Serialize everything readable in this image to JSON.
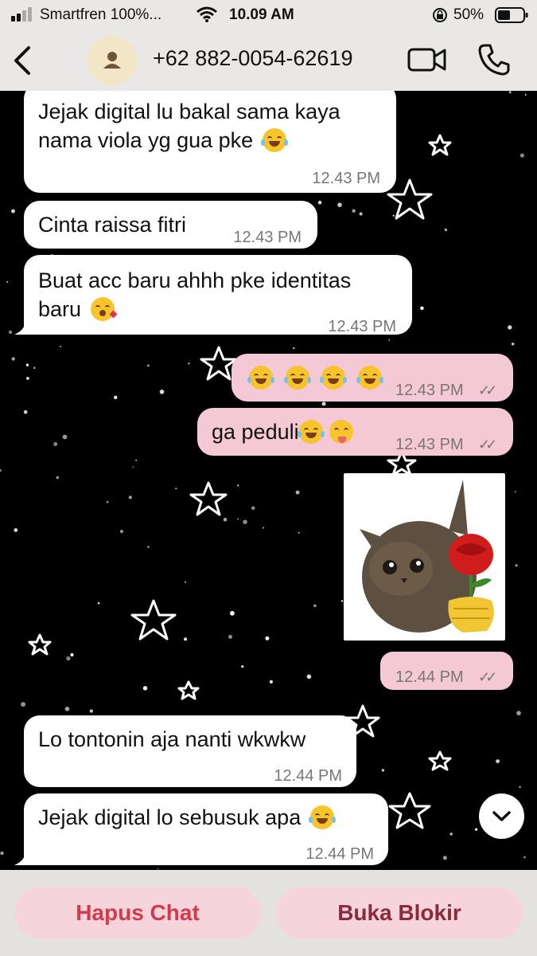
{
  "status_bar": {
    "carrier": "Smartfren 100%...",
    "time": "10.09 AM",
    "battery": "50%"
  },
  "header": {
    "back_icon": "chevron-left-icon",
    "contact_name": "+62 882-0054-62619",
    "video_icon": "video-camera-icon",
    "call_icon": "phone-icon"
  },
  "messages": [
    {
      "direction": "in",
      "lines": [
        "Jejak digital lu bakal sama kaya",
        "nama viola yg gua pke"
      ],
      "emoji": "rofl",
      "time": "12.43 PM"
    },
    {
      "direction": "in",
      "lines": [
        "Cinta raissa fitri"
      ],
      "time": "12.43 PM"
    },
    {
      "direction": "in",
      "lines": [
        "Buat acc baru ahhh pke identitas",
        "baru"
      ],
      "emoji": "kissing-heart",
      "time": "12.43 PM"
    },
    {
      "direction": "out",
      "lines": [
        ""
      ],
      "emoji": "joy x4",
      "time": "12.43 PM",
      "status": "read"
    },
    {
      "direction": "out",
      "lines": [
        "ga peduli"
      ],
      "emoji": "joy, winking-tongue",
      "time": "12.43 PM",
      "status": "read"
    },
    {
      "direction": "out",
      "type": "sticker",
      "sticker": "kitten-with-rose-sticker",
      "time": "12.44 PM",
      "status": "read"
    },
    {
      "direction": "in",
      "lines": [
        "Lo tontonin aja nanti wkwkw"
      ],
      "time": "12.44 PM"
    },
    {
      "direction": "in",
      "lines": [
        "Jejak digital lo sebusuk apa"
      ],
      "emoji": "rofl",
      "time": "12.44 PM"
    }
  ],
  "scroll_down_icon": "chevron-down-icon",
  "actions": {
    "delete_chat": "Hapus Chat",
    "unblock": "Buka Blokir"
  },
  "colors": {
    "incoming_bubble": "#ffffff",
    "outgoing_bubble": "#f5c8d5",
    "chat_background": "#000000",
    "delete_text": "#d23b4b",
    "unblock_text": "#8a2a3a",
    "button_bg": "#f6d4dc"
  }
}
